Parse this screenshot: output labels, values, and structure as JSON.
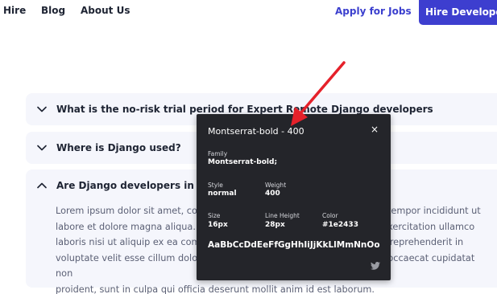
{
  "nav": {
    "links": [
      "Hire",
      "Blog",
      "About Us"
    ],
    "apply_label": "Apply for Jobs",
    "hire_label": "Hire Developers"
  },
  "faq": [
    {
      "question": "What is the no-risk trial period for Expert Remote Django developers",
      "expanded": false
    },
    {
      "question": "Where is Django used?",
      "expanded": false
    },
    {
      "question": "Are Django developers in demand?",
      "expanded": true,
      "answer_lines": [
        "Lorem ipsum dolor sit amet, consectetur adipiscing elit, sed do eiusmod tempor incididunt ut",
        "labore et dolore magna aliqua. Ut enim ad minim veniam, quis nostrud exercitation ullamco",
        "laboris nisi ut aliquip ex ea commodo consequat. Duis aute irure dolor in reprehenderit in",
        "voluptate velit esse cillum dolore eu fugiat nulla pariatur. Excepteur sint occaecat cupidatat non",
        "proident, sunt in culpa qui officia deserunt mollit anim id est laborum."
      ]
    }
  ],
  "font_inspector": {
    "title": "Montserrat-bold - 400",
    "close_icon": "×",
    "family_label": "Family",
    "family_value": "Montserrat-bold;",
    "style_label": "Style",
    "style_value": "normal",
    "weight_label": "Weight",
    "weight_value": "400",
    "size_label": "Size",
    "size_value": "16px",
    "line_height_label": "Line Height",
    "line_height_value": "28px",
    "color_label": "Color",
    "color_value": "#1e2433",
    "sample": "AaBbCcDdEeFfGgHhIiJjKkLlMmNnOoPpQqRrSsTtUuVvWwXxYyZz"
  },
  "colors": {
    "brand_blue": "#3d3ecf",
    "text_dark": "#1e2433",
    "faq_bg": "#f5f6fc",
    "popup_bg": "#24252a",
    "arrow_red": "#e5212a"
  }
}
